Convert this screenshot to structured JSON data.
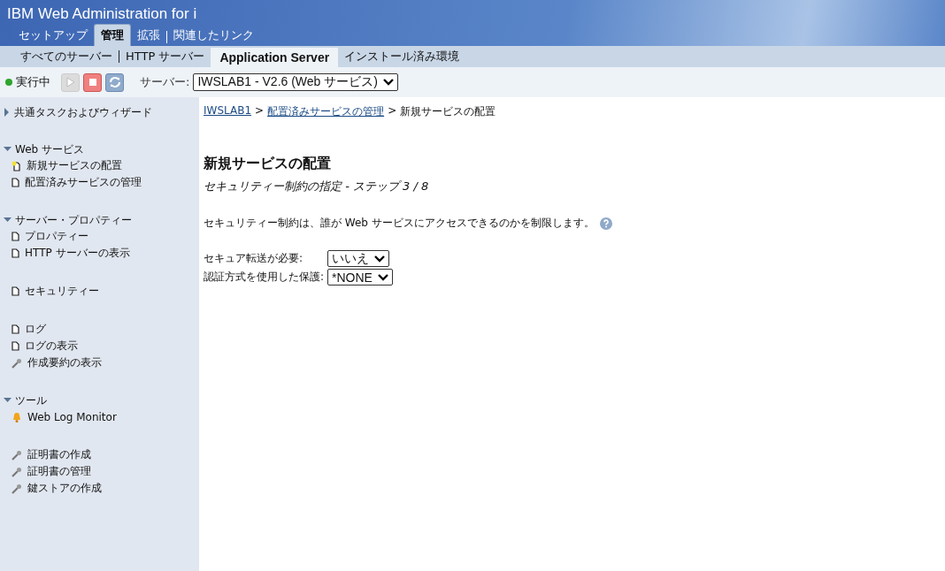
{
  "header": {
    "title": "IBM Web Administration for i"
  },
  "main_tabs": [
    {
      "label": "セットアップ",
      "selected": false
    },
    {
      "label": "管理",
      "selected": true
    },
    {
      "label": "拡張",
      "selected": false
    },
    {
      "label": "関連したリンク",
      "selected": false
    }
  ],
  "sub_tabs": [
    {
      "label": "すべてのサーバー",
      "selected": false
    },
    {
      "label": "HTTP サーバー",
      "selected": false
    },
    {
      "label": "Application Server",
      "selected": true
    },
    {
      "label": "インストール済み環境",
      "selected": false
    }
  ],
  "toolbar": {
    "status": "実行中",
    "start_disabled": true,
    "server_label": "サーバー:",
    "server_value": "IWSLAB1 - V2.6 (Web サービス)"
  },
  "sidebar": [
    {
      "title": "共通タスクおよびウィザード",
      "expanded": false
    },
    {
      "title": "Web サービス",
      "expanded": true,
      "items": [
        {
          "kind": "new",
          "label": "新規サービスの配置"
        },
        {
          "kind": "page",
          "label": "配置済みサービスの管理"
        }
      ]
    },
    {
      "title": "サーバー・プロパティー",
      "expanded": true,
      "items": [
        {
          "kind": "page",
          "label": "プロパティー"
        },
        {
          "kind": "page",
          "label": "HTTP サーバーの表示"
        }
      ]
    },
    {
      "items": [
        {
          "kind": "page",
          "label": "セキュリティー"
        }
      ]
    },
    {
      "items": [
        {
          "kind": "page",
          "label": "ログ"
        },
        {
          "kind": "page",
          "label": "ログの表示"
        },
        {
          "kind": "tool",
          "label": "作成要約の表示"
        }
      ]
    },
    {
      "title": "ツール",
      "expanded": true,
      "items": [
        {
          "kind": "bell",
          "label": "Web Log Monitor"
        }
      ]
    },
    {
      "items": [
        {
          "kind": "tool",
          "label": "証明書の作成"
        },
        {
          "kind": "tool",
          "label": "証明書の管理"
        },
        {
          "kind": "tool",
          "label": "鍵ストアの作成"
        }
      ]
    }
  ],
  "breadcrumb": [
    {
      "label": "IWSLAB1",
      "link": true
    },
    {
      "label": "配置済みサービスの管理",
      "link": true
    },
    {
      "label": "新規サービスの配置",
      "link": false
    }
  ],
  "breadcrumb_separator": ">",
  "page": {
    "title": "新規サービスの配置",
    "subtitle": "セキュリティー制約の指定 - ステップ 3 / 8",
    "description": "セキュリティー制約は、誰が Web サービスにアクセスできるのかを制限します。"
  },
  "fields": [
    {
      "label": "セキュア転送が必要:",
      "value": "いいえ"
    },
    {
      "label": "認証方式を使用した保護:",
      "value": "*NONE"
    }
  ]
}
